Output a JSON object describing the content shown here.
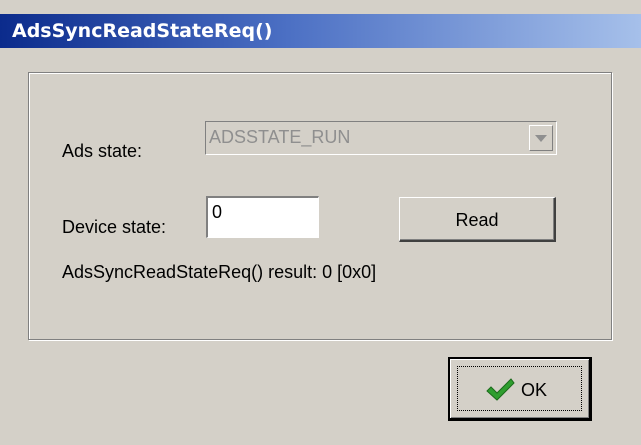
{
  "window": {
    "title": "AdsSyncReadStateReq()"
  },
  "form": {
    "ads_state_label": "Ads state:",
    "ads_state_value": "ADSSTATE_RUN",
    "device_state_label": "Device state:",
    "device_state_value": "0",
    "read_button": "Read",
    "result_text": "AdsSyncReadStateReq() result: 0 [0x0]"
  },
  "footer": {
    "ok_button": "OK"
  },
  "icons": {
    "combo_arrow": "chevron-down-icon",
    "ok": "checkmark-icon"
  },
  "colors": {
    "title_gradient_start": "#0b2b8c",
    "title_gradient_end": "#a6c0ea",
    "dialog_background": "#d4d0c8",
    "disabled_text": "#8f8f8f",
    "checkmark_green": "#2f9e2f"
  }
}
